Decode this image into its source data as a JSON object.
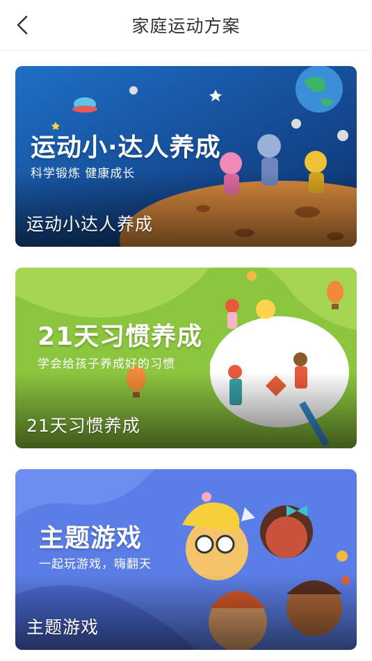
{
  "header": {
    "title": "家庭运动方案"
  },
  "cards": [
    {
      "label": "运动小达人养成",
      "banner_title": "运动小·达人养成",
      "banner_subtitle": "科学锻炼   健康成长",
      "accent": "#1d5aa8"
    },
    {
      "label": "21天习惯养成",
      "banner_title": "21天习惯养成",
      "banner_subtitle": "学会给孩子养成好的习惯",
      "accent": "#8cc63e"
    },
    {
      "label": "主题游戏",
      "banner_title": "主题游戏",
      "banner_subtitle": "一起玩游戏，嗨翻天",
      "accent": "#5b7ee6"
    }
  ],
  "icons": {
    "back": "chevron-left-icon"
  }
}
